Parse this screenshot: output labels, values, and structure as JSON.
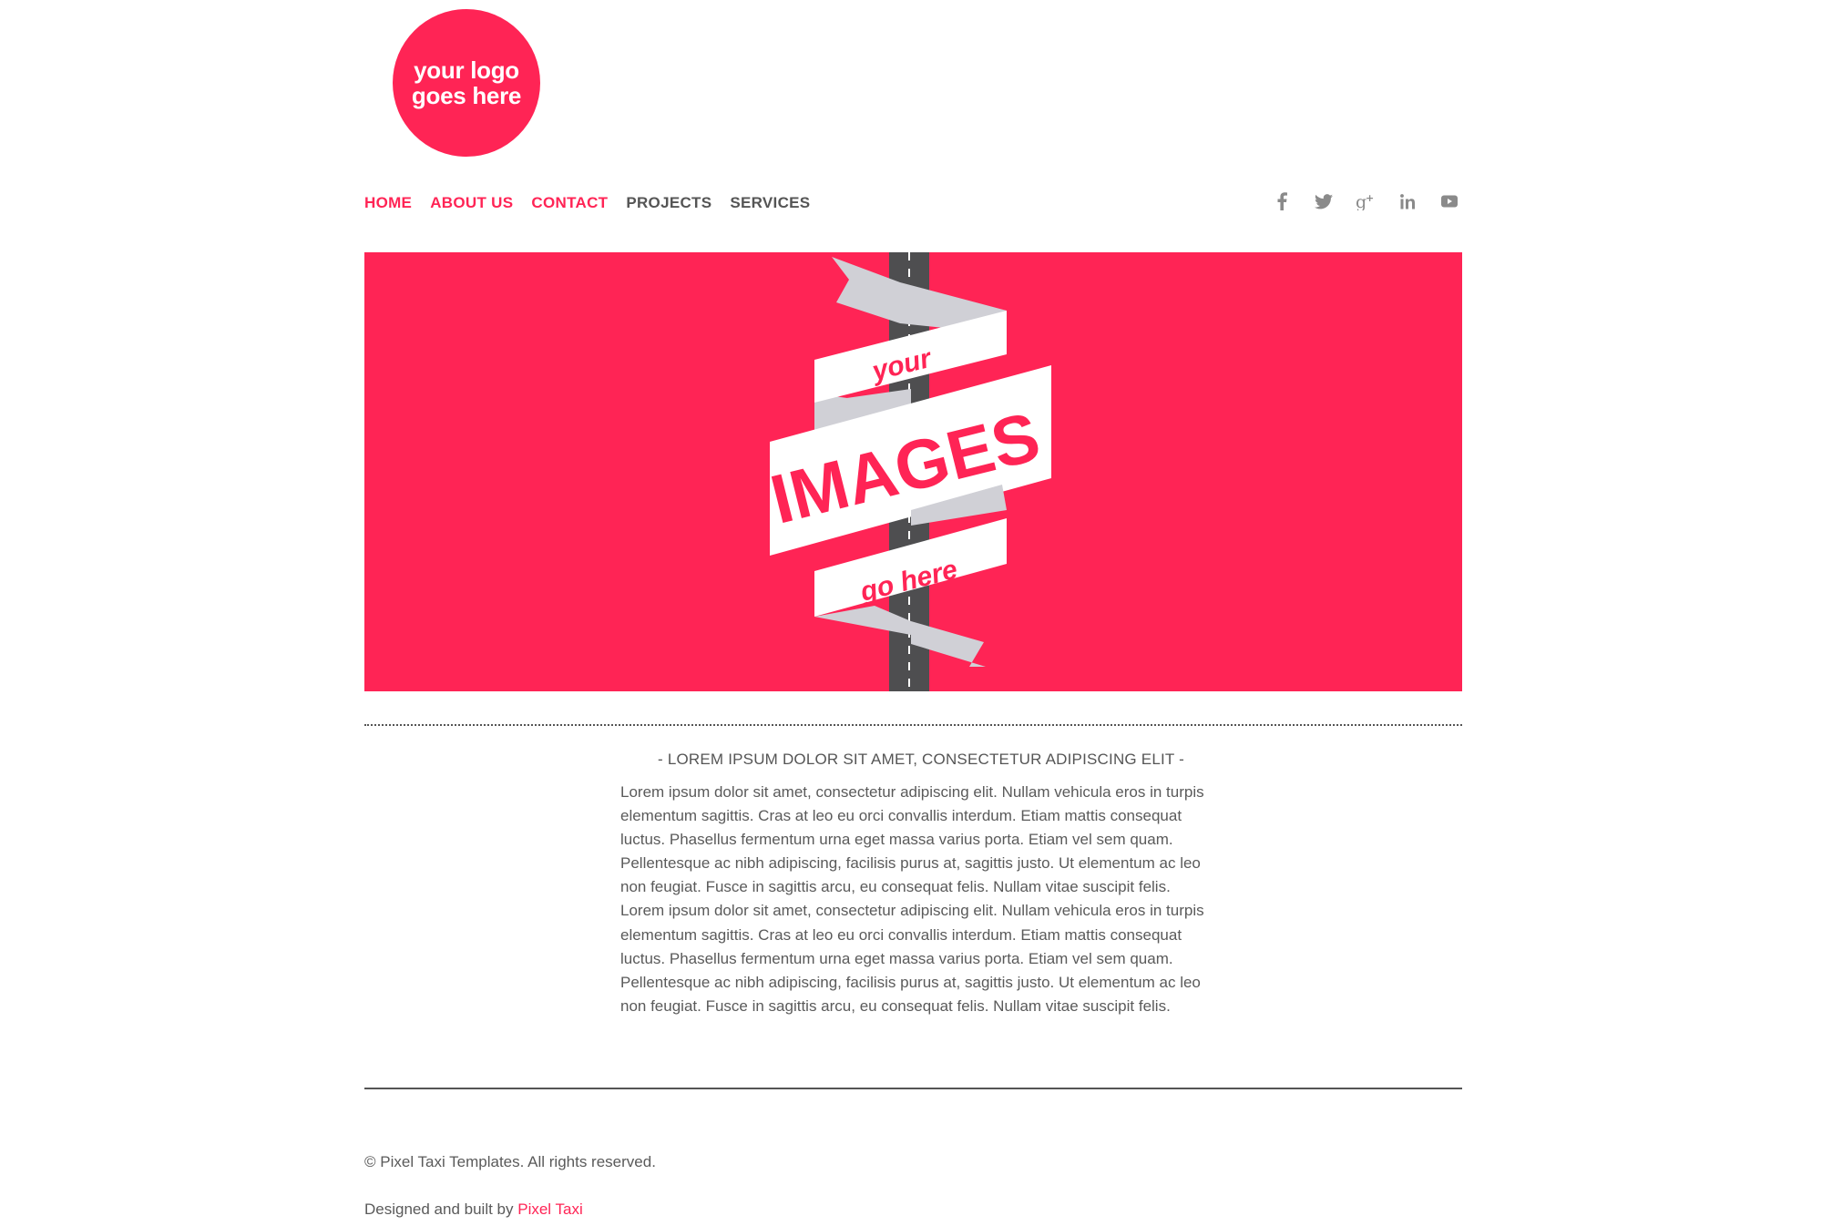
{
  "colors": {
    "accent": "#ff2455",
    "nav_inactive": "#555555",
    "ribbon": "#ffffff",
    "ribbon_shadow": "#d0d0d6",
    "road": "#4e4e50"
  },
  "logo": {
    "line1": "your logo",
    "line2": "goes here"
  },
  "nav": {
    "items": [
      {
        "label": "HOME",
        "color": "#ff2455"
      },
      {
        "label": "ABOUT US",
        "color": "#ff2455"
      },
      {
        "label": "CONTACT",
        "color": "#ff2455"
      },
      {
        "label": "PROJECTS",
        "color": "#555555"
      },
      {
        "label": "SERVICES",
        "color": "#555555"
      }
    ]
  },
  "social": [
    {
      "icon": "facebook-icon"
    },
    {
      "icon": "twitter-icon"
    },
    {
      "icon": "google-plus-icon"
    },
    {
      "icon": "linkedin-icon"
    },
    {
      "icon": "youtube-icon"
    }
  ],
  "hero": {
    "word_top": "your",
    "word_main": "IMAGES",
    "word_bottom": "go here"
  },
  "article": {
    "heading": "- LOREM IPSUM DOLOR SIT AMET, CONSECTETUR ADIPISCING ELIT -",
    "body": "Lorem ipsum dolor sit amet, consectetur adipiscing elit. Nullam vehicula eros in turpis elementum sagittis. Cras at leo eu orci convallis interdum. Etiam mattis consequat luctus. Phasellus fermentum urna eget massa varius porta. Etiam vel sem quam. Pellentesque ac nibh adipiscing, facilisis purus at, sagittis justo. Ut elementum ac leo non feugiat. Fusce in sagittis arcu, eu consequat felis. Nullam vitae suscipit felis. Lorem ipsum dolor sit amet, consectetur adipiscing elit. Nullam vehicula eros in turpis elementum sagittis. Cras at leo eu orci convallis interdum. Etiam mattis consequat luctus. Phasellus fermentum urna eget massa varius porta. Etiam vel sem quam. Pellentesque ac nibh adipiscing, facilisis purus at, sagittis justo. Ut elementum ac leo non feugiat. Fusce in sagittis arcu, eu consequat felis. Nullam vitae suscipit felis."
  },
  "footer": {
    "copyright": "© Pixel Taxi Templates. All rights reserved.",
    "credit_prefix": "Designed and built by ",
    "credit_link": "Pixel Taxi"
  }
}
